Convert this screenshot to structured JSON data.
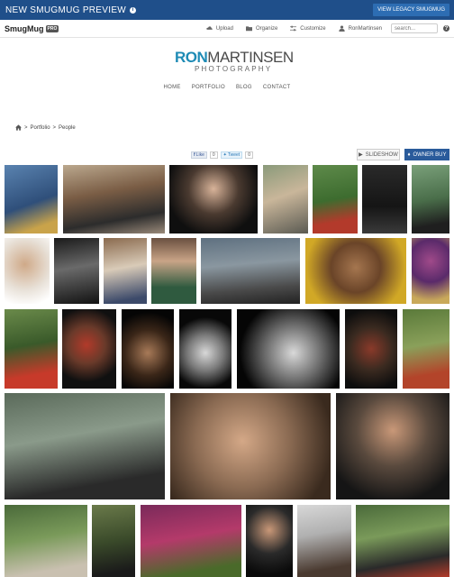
{
  "preview_bar": {
    "title": "NEW SMUGMUG PREVIEW",
    "info_icon": "i",
    "legacy_button": "VIEW LEGACY SMUGMUG"
  },
  "toolbar": {
    "logo": "SmugMug",
    "pro_badge": "PRO",
    "upload": "Upload",
    "organize": "Organize",
    "customize": "Customize",
    "user": "RonMartinsen",
    "search_placeholder": "search...",
    "help_icon": "?"
  },
  "site": {
    "logo_ron": "RON",
    "logo_martinsen": "MARTINSEN",
    "logo_sub": "PHOTOGRAPHY",
    "nav": [
      "HOME",
      "PORTFOLIO",
      "BLOG",
      "CONTACT"
    ]
  },
  "breadcrumb": {
    "separator": ">",
    "portfolio": "Portfolio",
    "current": "People"
  },
  "social": {
    "like_label": "Like",
    "like_count": "0",
    "tweet_label": "Tweet",
    "tweet_count": "0"
  },
  "actions": {
    "slideshow": "SLIDESHOW",
    "owner_buy": "OWNER BUY"
  },
  "colors": {
    "preview_bar": "#1f4f8a",
    "brand_accent": "#1e8bb5",
    "owner_buy": "#2a5b9b"
  },
  "photos": [
    {
      "desc": "woman-floral-top",
      "bg": "linear-gradient(160deg,#5a83b0 0%,#2f4f7a 55%,#c9a34a 85%)"
    },
    {
      "desc": "tattooed-arms-bike",
      "bg": "linear-gradient(170deg,#bba88e 0%,#7a5d45 40%,#2c2c2c 75%,#9a8a7a 100%)"
    },
    {
      "desc": "woman-laughing-hands-hair",
      "bg": "radial-gradient(circle at 50% 35%,#d8b399 0%,#4a3a30 40%,#0f0f0f 75%)"
    },
    {
      "desc": "bikini-rocks",
      "bg": "linear-gradient(160deg,#8a9a7a 0%,#c9b69a 45%,#5a5a52 100%)"
    },
    {
      "desc": "woman-red-dress-grass",
      "bg": "linear-gradient(170deg,#5e8a4a 0%,#3d6c2f 50%,#b33a2b 80%)"
    },
    {
      "desc": "woman-black-standing",
      "bg": "linear-gradient(180deg,#2a2a2a 0%,#151515 60%,#3a3a3a 100%)"
    },
    {
      "desc": "woman-outdoors-black",
      "bg": "linear-gradient(170deg,#7aa07a 0%,#4a6e4a 50%,#1f1f1f 85%)"
    },
    {
      "desc": "woman-smiling-white",
      "bg": "radial-gradient(circle at 45% 40%,#cfa988 0%,#e8e1d8 55%,#ffffff 90%)"
    },
    {
      "desc": "woman-bw-sitting",
      "bg": "linear-gradient(170deg,#1a1a1a 0%,#6a6a6a 45%,#121212 100%)"
    },
    {
      "desc": "blonde-corset",
      "bg": "linear-gradient(170deg,#8a6a4e 0%,#d9cbb8 45%,#3c4a6a 90%)"
    },
    {
      "desc": "girl-hollister",
      "bg": "linear-gradient(180deg,#6a5040 0%,#c9a487 35%,#2f5a3f 75%)"
    },
    {
      "desc": "woman-lying-rocks",
      "bg": "linear-gradient(175deg,#5e7080 0%,#8a97a0 40%,#4a4a4a 75%,#222 100%)"
    },
    {
      "desc": "child-yellow-hood",
      "bg": "radial-gradient(circle at 50% 45%,#a5764f 0%,#6a4428 40%,#d1a826 80%)"
    },
    {
      "desc": "masked-woman",
      "bg": "radial-gradient(circle at 50% 35%,#a04a8a 0%,#5a2a6a 45%,#c9a95a 85%)"
    },
    {
      "desc": "woman-colorful-coat",
      "bg": "linear-gradient(170deg,#6a8a4a 0%,#3a5a2a 45%,#c73a2a 80%)"
    },
    {
      "desc": "woman-red-hat",
      "bg": "radial-gradient(circle at 45% 45%,#b23a2a 0%,#6a3a2a 35%,#101010 70%)"
    },
    {
      "desc": "pregnant-woman",
      "bg": "radial-gradient(circle at 50% 55%,#a87a58 0%,#3a2618 45%,#050505 80%)"
    },
    {
      "desc": "pregnant-bw",
      "bg": "radial-gradient(circle at 50% 55%,#d8d8d8 0%,#7a7a7a 35%,#080808 70%)"
    },
    {
      "desc": "babies-bw",
      "bg": "radial-gradient(circle at 55% 55%,#d9d9d9 0%,#6a6a6a 40%,#050505 75%)"
    },
    {
      "desc": "toddler-overalls",
      "bg": "radial-gradient(circle at 50% 50%,#8a3a2a 0%,#3a2a20 45%,#0d0d0d 85%)"
    },
    {
      "desc": "woman-kimono-garden",
      "bg": "linear-gradient(170deg,#5a7a3a 0%,#8aa05a 45%,#b3442a 80%)"
    },
    {
      "desc": "feet-flipflops",
      "bg": "linear-gradient(170deg,#5a6a5a 0%,#8a9a8a 40%,#2a2a2a 80%)"
    },
    {
      "desc": "baby-crawling",
      "bg": "radial-gradient(circle at 45% 45%,#d4a887 0%,#8a6a52 45%,#3a2a1e 85%)"
    },
    {
      "desc": "woman-hands-face",
      "bg": "radial-gradient(circle at 50% 35%,#c99878 0%,#5a4a3e 40%,#151515 80%)"
    },
    {
      "desc": "woman-leaves",
      "bg": "linear-gradient(170deg,#4a6a3a 0%,#7a9a5a 45%,#c9c0b0 85%)"
    },
    {
      "desc": "woman-park",
      "bg": "linear-gradient(170deg,#6a7a4a 0%,#3a4a2a 50%,#1a1a1a 90%)"
    },
    {
      "desc": "girl-tulips",
      "bg": "linear-gradient(170deg,#7a2a5a 0%,#b43a6a 45%,#4a6a2a 85%)"
    },
    {
      "desc": "woman-black-hair",
      "bg": "radial-gradient(circle at 50% 35%,#c99878 0%,#2a2a2a 45%,#0a0a0a 85%)"
    },
    {
      "desc": "woman-wind-hair",
      "bg": "linear-gradient(170deg,#d8d8d8 0%,#b0b0b0 40%,#4a3a30 85%)"
    },
    {
      "desc": "father-baby",
      "bg": "linear-gradient(170deg,#4a6a3a 0%,#7a9a5a 40%,#2a2a2a 75%,#b33a2a 100%)"
    }
  ]
}
